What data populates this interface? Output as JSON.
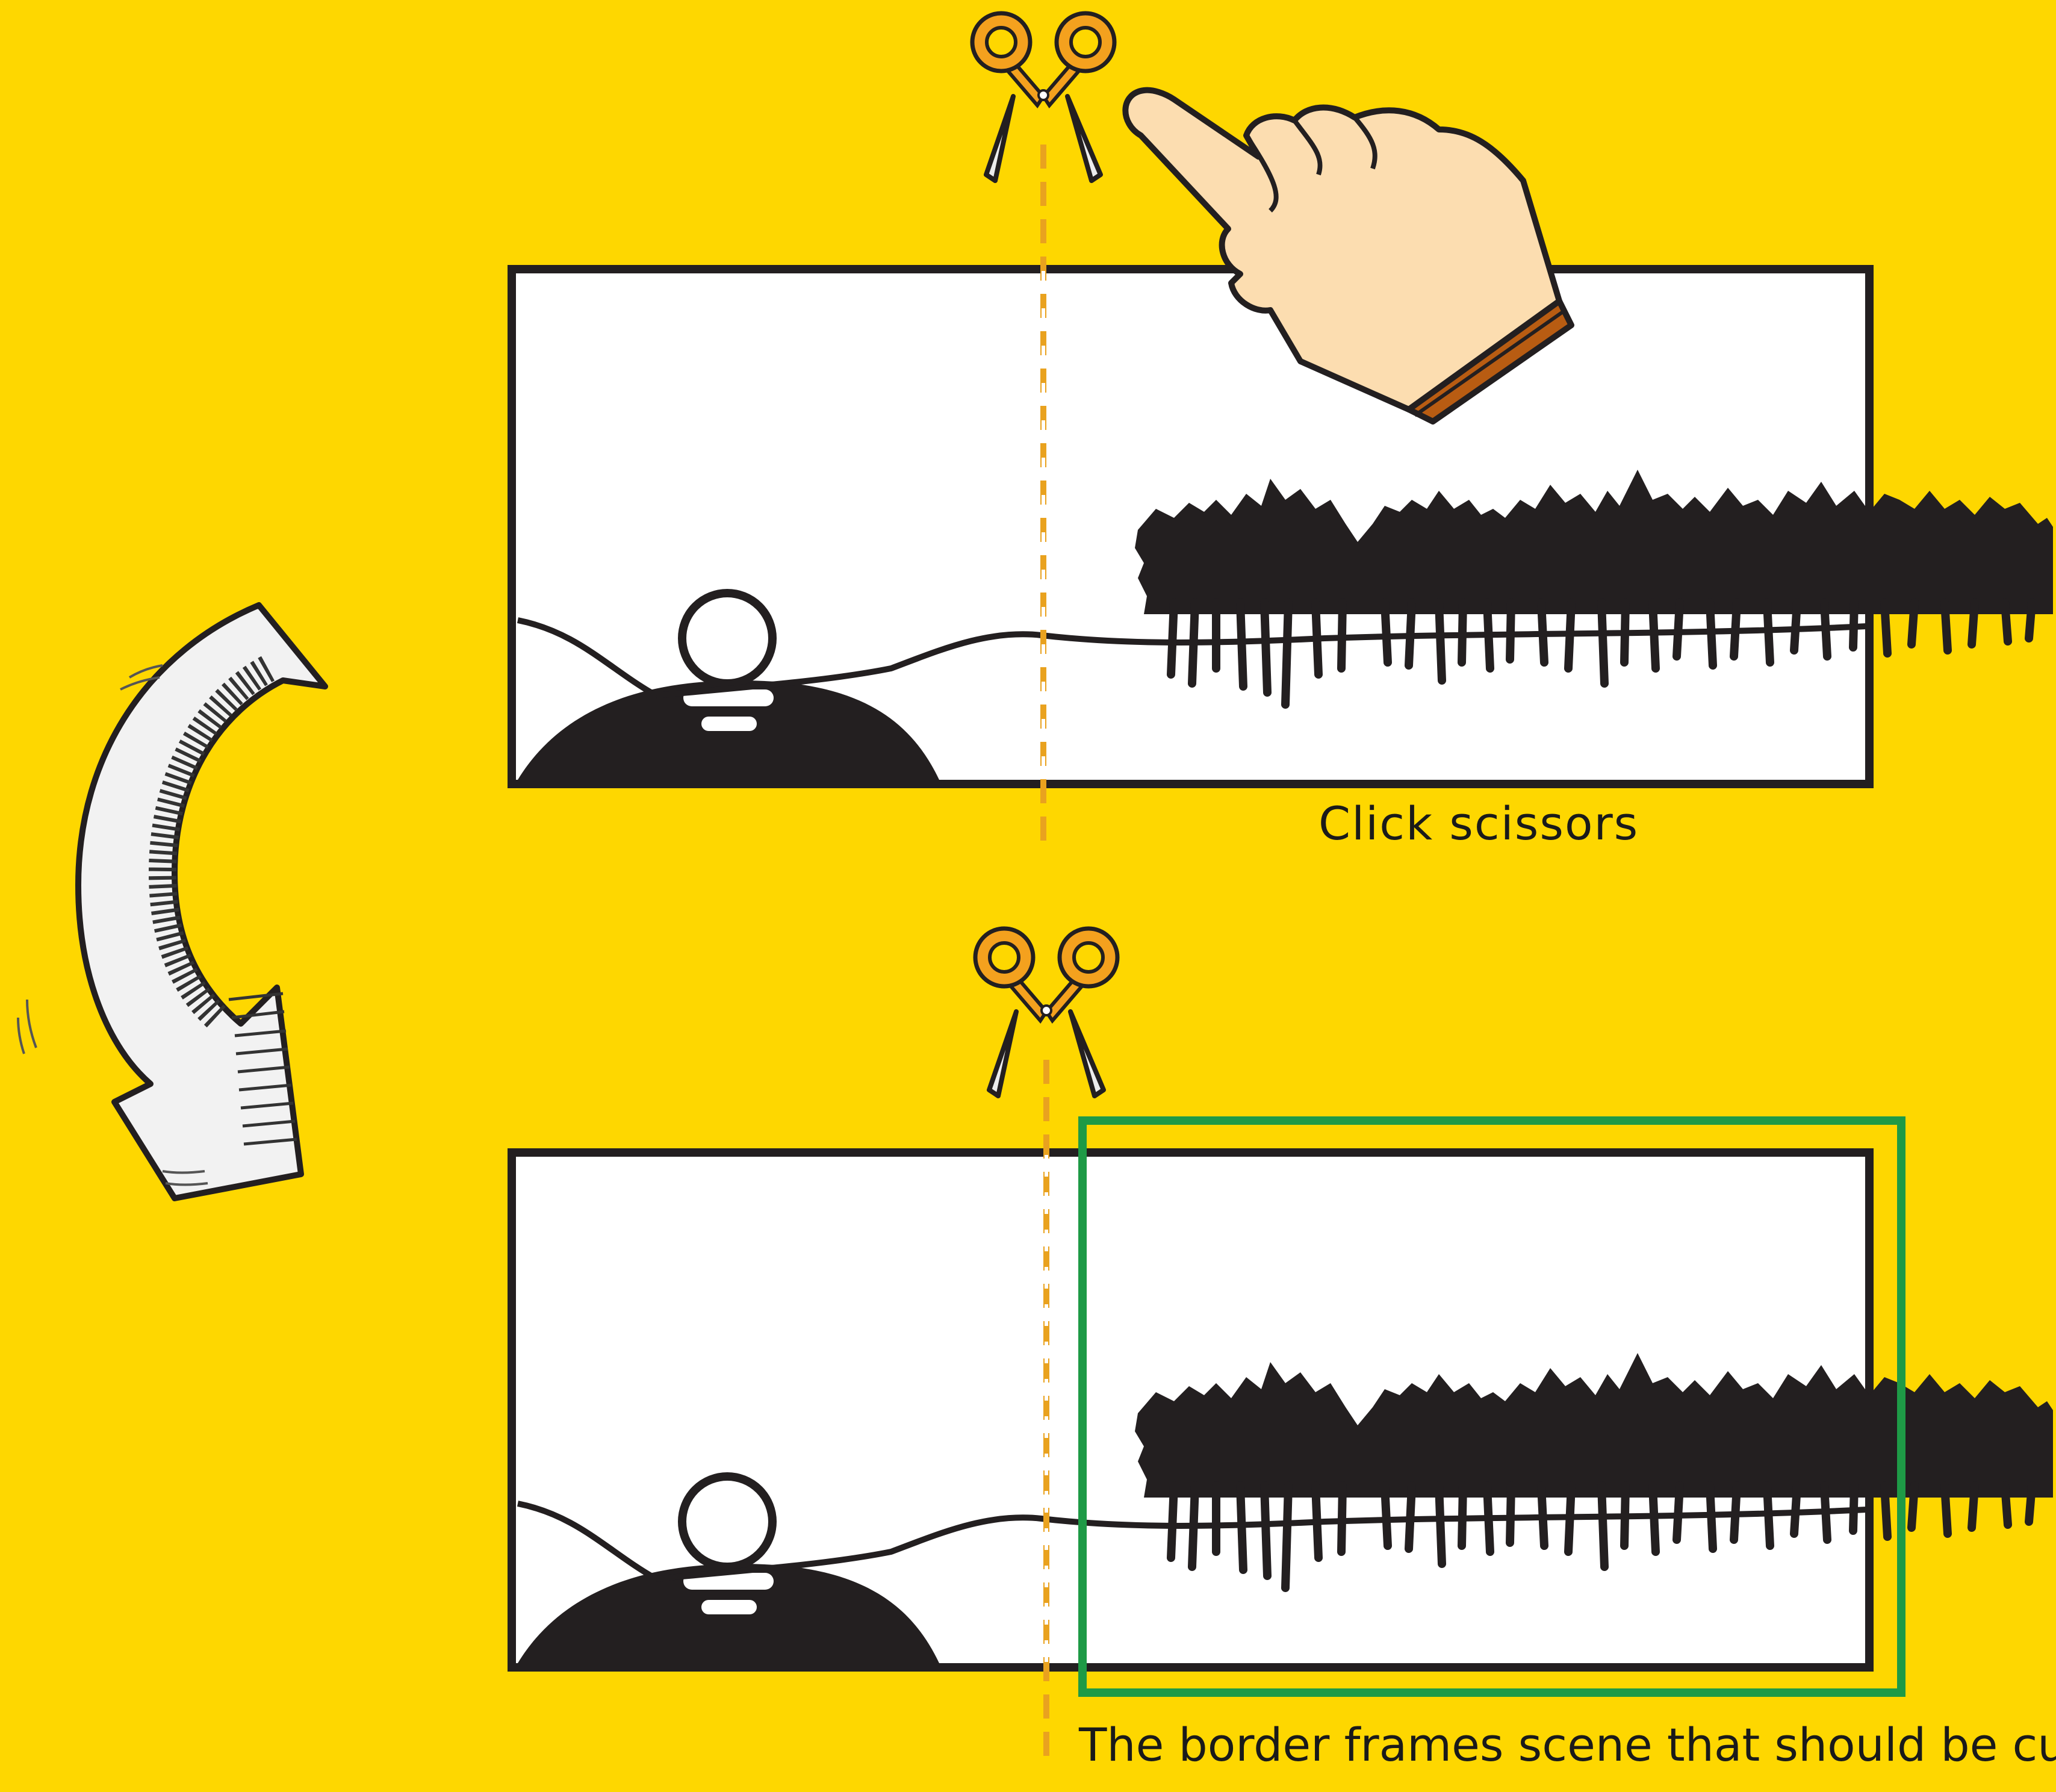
{
  "instructions": {
    "step1_caption": "Click scissors",
    "step2_caption": "The border frames scene that should be cut"
  },
  "colors": {
    "background": "#FED700",
    "cut_line": "#E9A21F",
    "highlight_border": "#1E9A46",
    "scissors_handle": "#F4A11E",
    "scene_fill": "#231F20"
  },
  "icons": {
    "scissors": "scissors-icon",
    "pointer": "pointing-hand-icon",
    "arrow": "curved-down-arrow-icon"
  }
}
